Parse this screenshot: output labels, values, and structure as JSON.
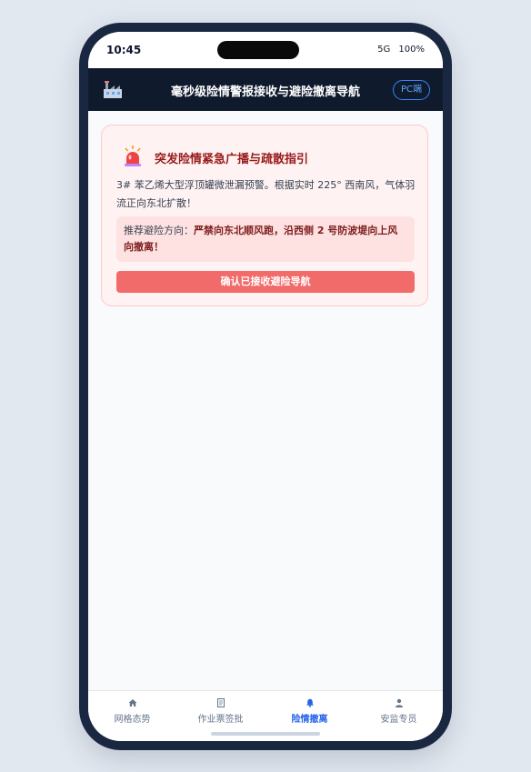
{
  "status_bar": {
    "time": "10:45",
    "network": "5G",
    "battery": "100%"
  },
  "header": {
    "icon": "factory-icon",
    "title": "毫秒级险情警报接收与避险撤离导航",
    "pc_label": "PC端"
  },
  "alert": {
    "icon": "siren-icon",
    "title": "突发险情紧急广播与疏散指引",
    "body": "3# 苯乙烯大型浮顶罐微泄漏预警。根据实时 225° 西南风，气体羽流正向东北扩散！",
    "advice_label": "推荐避险方向：",
    "advice_text": "严禁向东北顺风跑，沿西侧 2 号防波堤向上风向撤离！",
    "confirm_label": "确认已接收避险导航"
  },
  "tabs": [
    {
      "label": "网格态势",
      "icon": "home-icon",
      "active": false
    },
    {
      "label": "作业票签批",
      "icon": "document-icon",
      "active": false
    },
    {
      "label": "险情撤离",
      "icon": "bell-icon",
      "active": true
    },
    {
      "label": "安监专员",
      "icon": "user-icon",
      "active": false
    }
  ],
  "colors": {
    "frame": "#1a2740",
    "header_bg": "#0f1b2d",
    "alert_bg": "#fef2f2",
    "alert_title": "#991b1b",
    "confirm_button": "#f26b6b",
    "active_tab": "#2563eb"
  }
}
